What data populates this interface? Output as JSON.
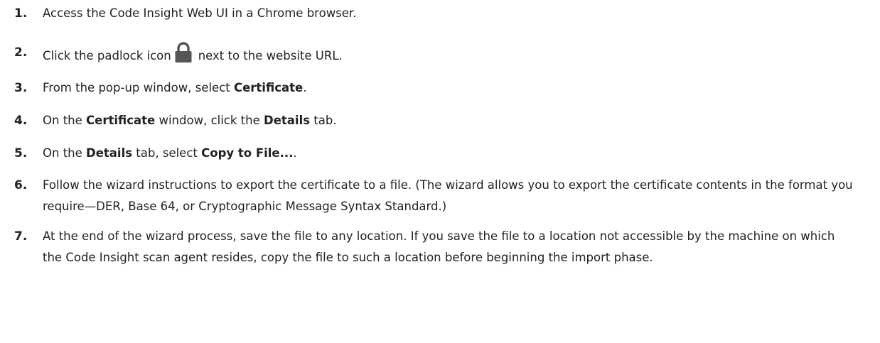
{
  "steps": [
    {
      "num": "1.",
      "parts": [
        "Access the Code Insight Web UI in a Chrome browser."
      ]
    },
    {
      "num": "2.",
      "before_icon": "Click the padlock icon",
      "icon": "padlock-icon",
      "after_icon": "next to the website URL."
    },
    {
      "num": "3.",
      "t1": "From the pop-up window, select ",
      "b1": "Certificate",
      "t2": "."
    },
    {
      "num": "4.",
      "t1": "On the ",
      "b1": "Certificate",
      "t2": " window, click the ",
      "b2": "Details",
      "t3": " tab."
    },
    {
      "num": "5.",
      "t1": "On the ",
      "b1": "Details",
      "t2": " tab, select ",
      "b2": "Copy to File...",
      "t3": "."
    },
    {
      "num": "6.",
      "text": "Follow the wizard instructions to export the certificate to a file. (The wizard allows you to export the certificate contents in the format you require—DER, Base 64, or Cryptographic Message Syntax Standard.)"
    },
    {
      "num": "7.",
      "text": "At the end of the wizard process, save the file to any location. If you save the file to a location not accessible by the machine on which the Code Insight scan agent resides, copy the file to such a location before beginning the import phase."
    }
  ],
  "colors": {
    "text": "#222222",
    "padlock": "#555555"
  }
}
